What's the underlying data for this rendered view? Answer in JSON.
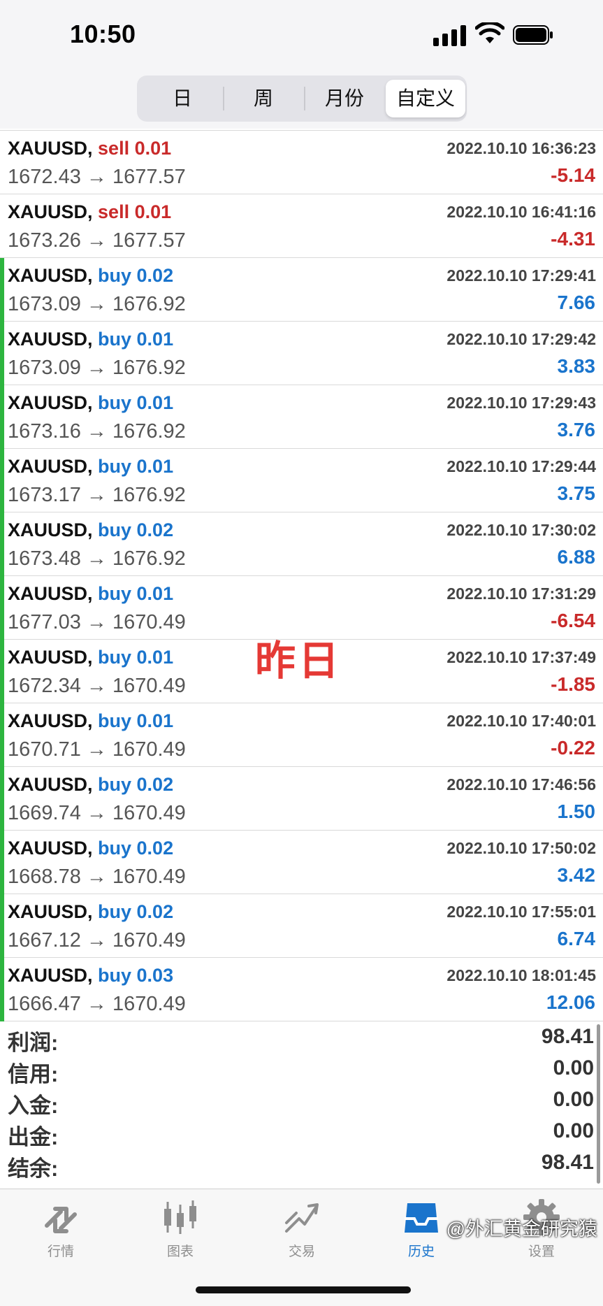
{
  "status_bar": {
    "time": "10:50"
  },
  "period_tabs": [
    {
      "label": "日",
      "active": false
    },
    {
      "label": "周",
      "active": false
    },
    {
      "label": "月份",
      "active": false
    },
    {
      "label": "自定义",
      "active": true
    }
  ],
  "deals": [
    {
      "symbol": "XAUUSD,",
      "side": "sell 0.01",
      "direction": "sell",
      "open": "1672.43",
      "close": "1677.57",
      "time": "2022.10.10 16:36:23",
      "profit": "-5.14"
    },
    {
      "symbol": "XAUUSD,",
      "side": "sell 0.01",
      "direction": "sell",
      "open": "1673.26",
      "close": "1677.57",
      "time": "2022.10.10 16:41:16",
      "profit": "-4.31"
    },
    {
      "symbol": "XAUUSD,",
      "side": "buy 0.02",
      "direction": "buy",
      "open": "1673.09",
      "close": "1676.92",
      "time": "2022.10.10 17:29:41",
      "profit": "7.66"
    },
    {
      "symbol": "XAUUSD,",
      "side": "buy 0.01",
      "direction": "buy",
      "open": "1673.09",
      "close": "1676.92",
      "time": "2022.10.10 17:29:42",
      "profit": "3.83"
    },
    {
      "symbol": "XAUUSD,",
      "side": "buy 0.01",
      "direction": "buy",
      "open": "1673.16",
      "close": "1676.92",
      "time": "2022.10.10 17:29:43",
      "profit": "3.76"
    },
    {
      "symbol": "XAUUSD,",
      "side": "buy 0.01",
      "direction": "buy",
      "open": "1673.17",
      "close": "1676.92",
      "time": "2022.10.10 17:29:44",
      "profit": "3.75"
    },
    {
      "symbol": "XAUUSD,",
      "side": "buy 0.02",
      "direction": "buy",
      "open": "1673.48",
      "close": "1676.92",
      "time": "2022.10.10 17:30:02",
      "profit": "6.88"
    },
    {
      "symbol": "XAUUSD,",
      "side": "buy 0.01",
      "direction": "buy",
      "open": "1677.03",
      "close": "1670.49",
      "time": "2022.10.10 17:31:29",
      "profit": "-6.54"
    },
    {
      "symbol": "XAUUSD,",
      "side": "buy 0.01",
      "direction": "buy",
      "open": "1672.34",
      "close": "1670.49",
      "time": "2022.10.10 17:37:49",
      "profit": "-1.85"
    },
    {
      "symbol": "XAUUSD,",
      "side": "buy 0.01",
      "direction": "buy",
      "open": "1670.71",
      "close": "1670.49",
      "time": "2022.10.10 17:40:01",
      "profit": "-0.22"
    },
    {
      "symbol": "XAUUSD,",
      "side": "buy 0.02",
      "direction": "buy",
      "open": "1669.74",
      "close": "1670.49",
      "time": "2022.10.10 17:46:56",
      "profit": "1.50"
    },
    {
      "symbol": "XAUUSD,",
      "side": "buy 0.02",
      "direction": "buy",
      "open": "1668.78",
      "close": "1670.49",
      "time": "2022.10.10 17:50:02",
      "profit": "3.42"
    },
    {
      "symbol": "XAUUSD,",
      "side": "buy 0.02",
      "direction": "buy",
      "open": "1667.12",
      "close": "1670.49",
      "time": "2022.10.10 17:55:01",
      "profit": "6.74"
    },
    {
      "symbol": "XAUUSD,",
      "side": "buy 0.03",
      "direction": "buy",
      "open": "1666.47",
      "close": "1670.49",
      "time": "2022.10.10 18:01:45",
      "profit": "12.06"
    }
  ],
  "arrow_glyph": "→",
  "overlay_text": "昨日",
  "summary": [
    {
      "label": "利润:",
      "value": "98.41"
    },
    {
      "label": "信用:",
      "value": "0.00"
    },
    {
      "label": "入金:",
      "value": "0.00"
    },
    {
      "label": "出金:",
      "value": "0.00"
    },
    {
      "label": "结余:",
      "value": "98.41"
    }
  ],
  "tabbar": [
    {
      "label": "行情",
      "icon": "quotes-icon",
      "active": false
    },
    {
      "label": "图表",
      "icon": "chart-icon",
      "active": false
    },
    {
      "label": "交易",
      "icon": "trade-icon",
      "active": false
    },
    {
      "label": "历史",
      "icon": "history-icon",
      "active": true
    },
    {
      "label": "设置",
      "icon": "settings-icon",
      "active": false
    }
  ],
  "credit": "@外汇黄金研究猿",
  "colors": {
    "buy": "#1a74cc",
    "sell": "#c92a2a",
    "accent": "#1a74cc",
    "bar": "#2db53f"
  }
}
